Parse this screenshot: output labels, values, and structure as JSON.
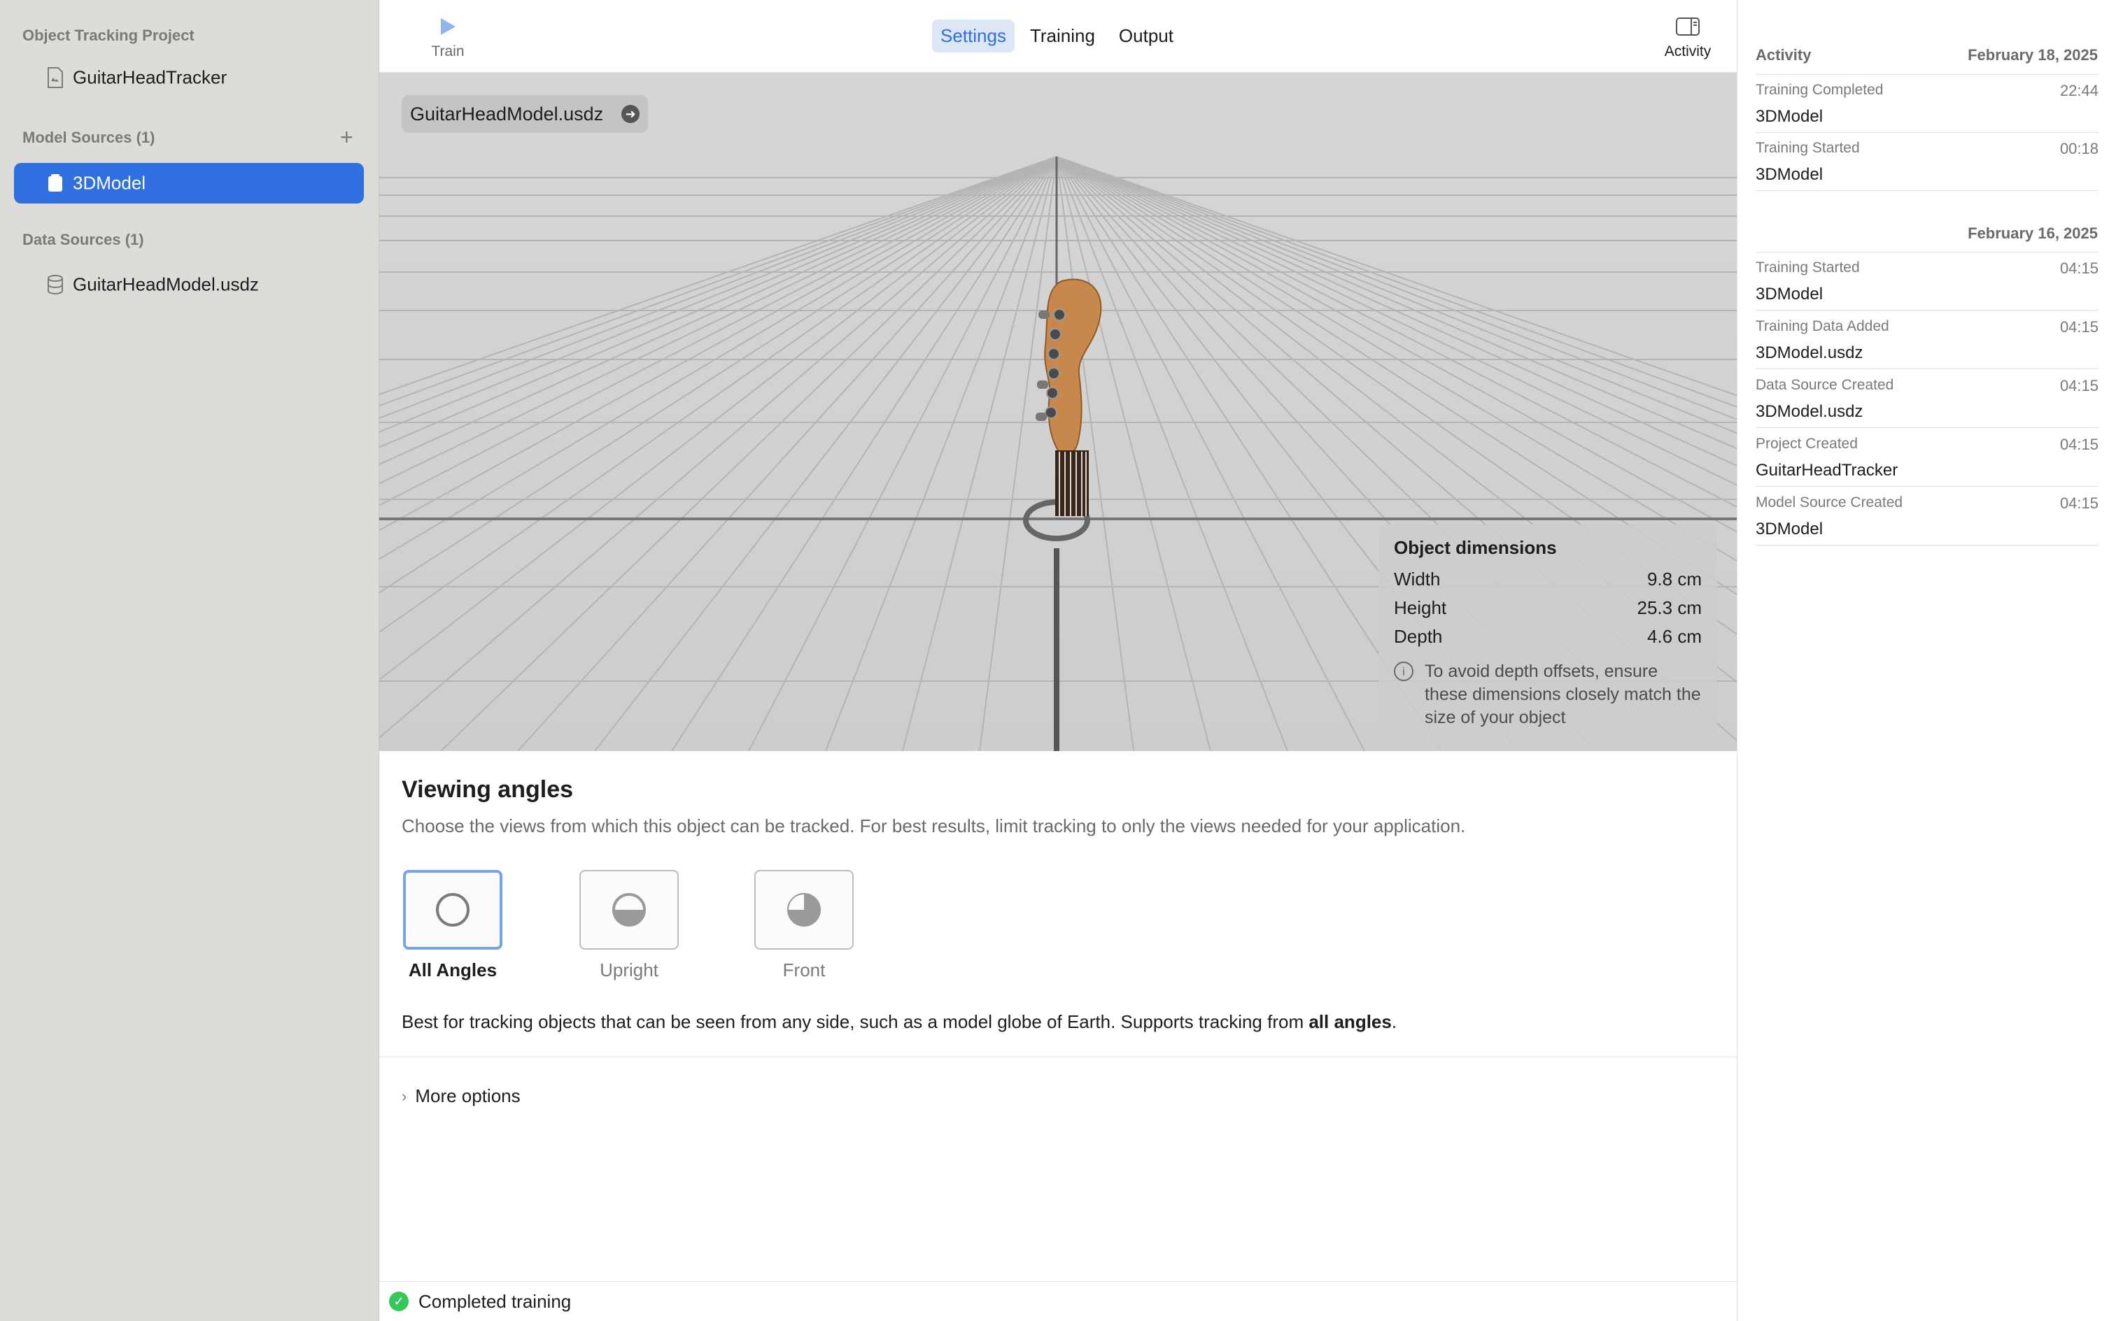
{
  "sidebar": {
    "project_heading": "Object Tracking Project",
    "project_name": "GuitarHeadTracker",
    "model_sources_heading": "Model Sources (1)",
    "model_sources": [
      {
        "label": "3DModel"
      }
    ],
    "data_sources_heading": "Data Sources (1)",
    "data_sources": [
      {
        "label": "GuitarHeadModel.usdz"
      }
    ]
  },
  "toolbar": {
    "train_label": "Train",
    "tabs": [
      {
        "label": "Settings"
      },
      {
        "label": "Training"
      },
      {
        "label": "Output"
      }
    ],
    "active_tab": "Settings",
    "activity_label": "Activity"
  },
  "viewport": {
    "file_chip": "GuitarHeadModel.usdz",
    "dimensions": {
      "title": "Object dimensions",
      "rows": [
        {
          "label": "Width",
          "value": "9.8 cm"
        },
        {
          "label": "Height",
          "value": "25.3 cm"
        },
        {
          "label": "Depth",
          "value": "4.6 cm"
        }
      ],
      "note": "To avoid depth offsets, ensure these dimensions closely match the size of your object"
    }
  },
  "viewing_angles": {
    "title": "Viewing angles",
    "description": "Choose the views from which this object can be tracked. For best results, limit tracking to only the views needed for your application.",
    "options": [
      {
        "label": "All Angles"
      },
      {
        "label": "Upright"
      },
      {
        "label": "Front"
      }
    ],
    "selected": "All Angles",
    "best_text_prefix": "Best for tracking objects that can be seen from any side, such as a model globe of Earth. Supports tracking from ",
    "best_text_bold": "all angles",
    "best_text_suffix": ".",
    "more_options": "More options"
  },
  "status": {
    "text": "Completed training",
    "color": "#34c759"
  },
  "activity": {
    "title": "Activity",
    "groups": [
      {
        "date": "February 18, 2025",
        "entries": [
          {
            "event": "Training Completed",
            "time": "22:44",
            "object": "3DModel"
          },
          {
            "event": "Training Started",
            "time": "00:18",
            "object": "3DModel"
          }
        ]
      },
      {
        "date": "February 16, 2025",
        "entries": [
          {
            "event": "Training Started",
            "time": "04:15",
            "object": "3DModel"
          },
          {
            "event": "Training Data Added",
            "time": "04:15",
            "object": "3DModel.usdz"
          },
          {
            "event": "Data Source Created",
            "time": "04:15",
            "object": "3DModel.usdz"
          },
          {
            "event": "Project Created",
            "time": "04:15",
            "object": "GuitarHeadTracker"
          },
          {
            "event": "Model Source Created",
            "time": "04:15",
            "object": "3DModel"
          }
        ]
      }
    ]
  },
  "colors": {
    "accent": "#2f6fe0",
    "sidebar_bg": "#dcdcd8",
    "success": "#34c759"
  }
}
